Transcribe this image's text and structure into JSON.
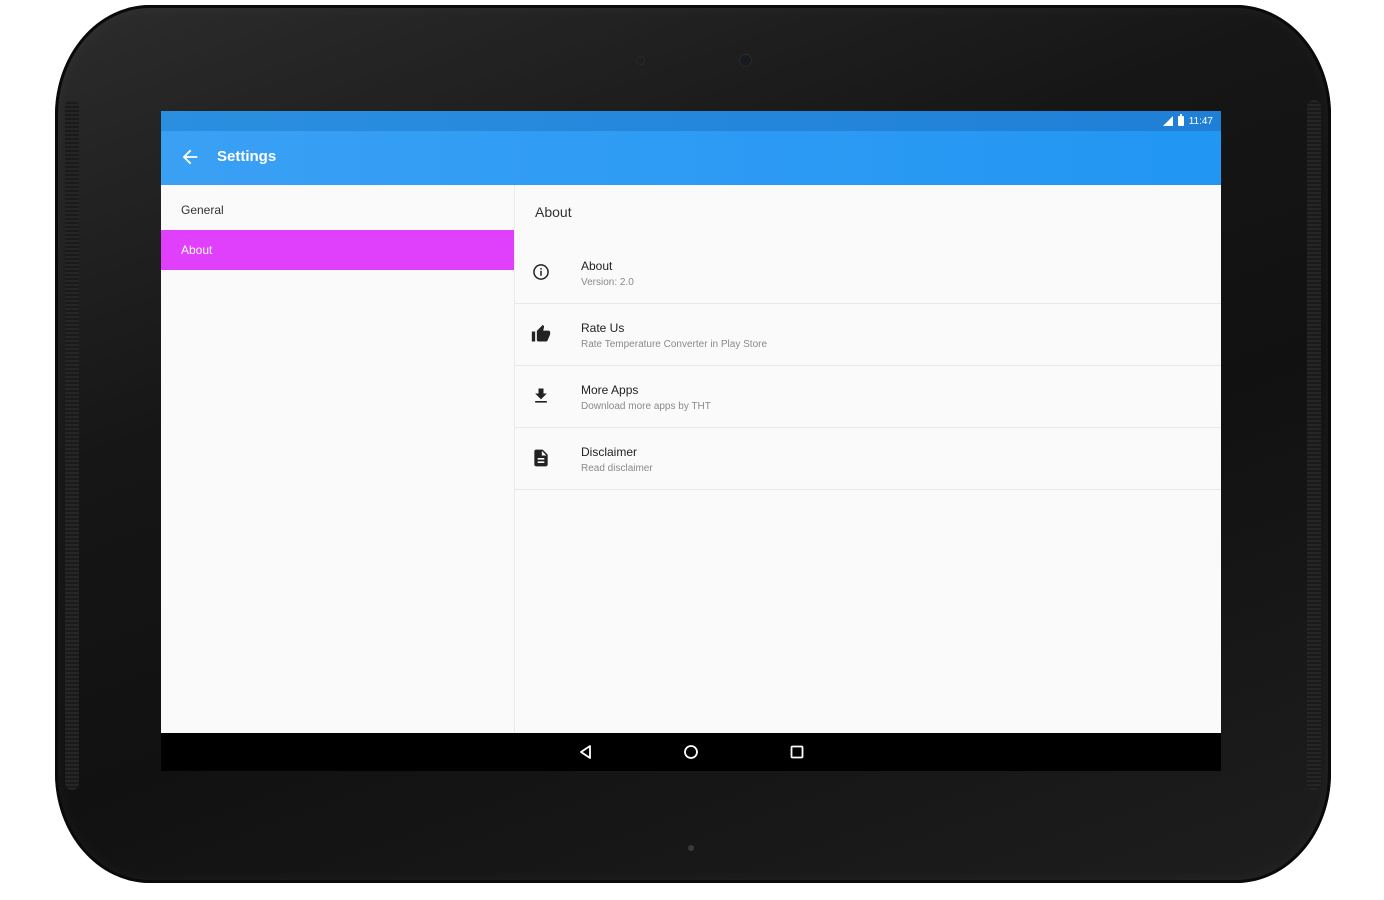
{
  "status_bar": {
    "time": "11:47",
    "icons": [
      "signal-icon",
      "battery-icon"
    ]
  },
  "app_bar": {
    "title": "Settings",
    "back_icon": "arrow-back-icon",
    "color": "#2196f3"
  },
  "headers": [
    {
      "label": "General",
      "selected": false
    },
    {
      "label": "About",
      "selected": true
    }
  ],
  "accent_color": "#e040fb",
  "detail": {
    "section_title": "About",
    "items": [
      {
        "title": "About",
        "summary": "Version: 2.0",
        "icon": "info-icon"
      },
      {
        "title": "Rate Us",
        "summary": "Rate Temperature Converter in Play Store",
        "icon": "thumb-up-icon"
      },
      {
        "title": "More Apps",
        "summary": "Download more apps by THT",
        "icon": "download-icon"
      },
      {
        "title": "Disclaimer",
        "summary": "Read disclaimer",
        "icon": "document-icon"
      }
    ]
  },
  "navigation_bar": {
    "buttons": [
      "back-icon",
      "home-icon",
      "recents-icon"
    ]
  }
}
